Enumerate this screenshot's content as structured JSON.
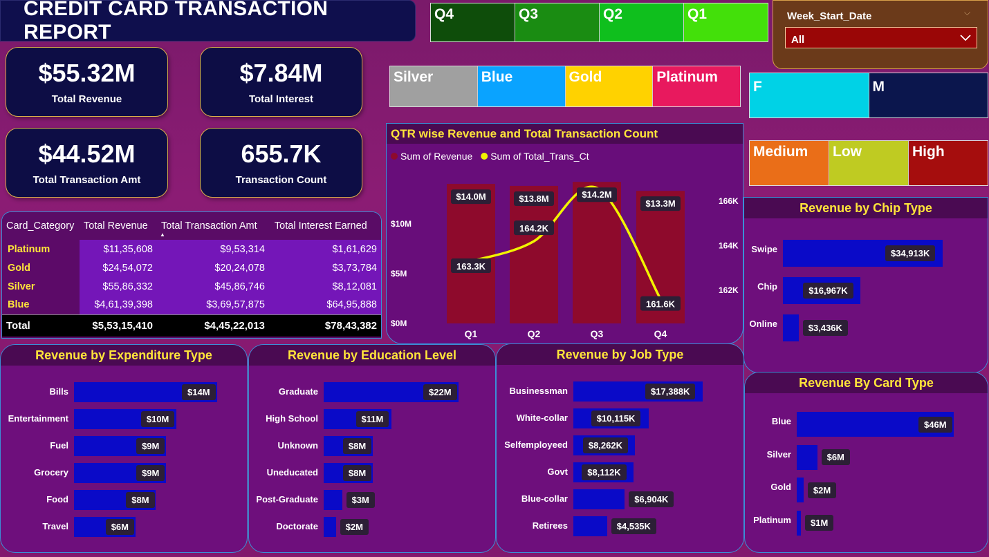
{
  "header": {
    "title": "CREDIT CARD TRANSACTION REPORT"
  },
  "kpis": [
    {
      "value": "$55.32M",
      "label": "Total Revenue"
    },
    {
      "value": "$7.84M",
      "label": "Total Interest"
    },
    {
      "value": "$44.52M",
      "label": "Total Transaction Amt"
    },
    {
      "value": "655.7K",
      "label": "Transaction Count"
    }
  ],
  "quarter_slicer": [
    {
      "label": "Q4",
      "color": "#0e4d0a"
    },
    {
      "label": "Q3",
      "color": "#1a8c12"
    },
    {
      "label": "Q2",
      "color": "#0fbf1d"
    },
    {
      "label": "Q1",
      "color": "#43e00a"
    }
  ],
  "week_slicer": {
    "label": "Week_Start_Date",
    "value": "All"
  },
  "card_slicer": [
    {
      "label": "Silver",
      "color": "#a0a0a0"
    },
    {
      "label": "Blue",
      "color": "#0aa3ff"
    },
    {
      "label": "Gold",
      "color": "#ffd200"
    },
    {
      "label": "Platinum",
      "color": "#e8195e"
    }
  ],
  "gender_slicer": [
    {
      "label": "F",
      "color": "#00d2e6"
    },
    {
      "label": "M",
      "color": "#0b164d"
    }
  ],
  "income_slicer": [
    {
      "label": "Medium",
      "color": "#ea6e18"
    },
    {
      "label": "Low",
      "color": "#bfcb22"
    },
    {
      "label": "High",
      "color": "#a50d0d"
    }
  ],
  "table": {
    "headers": [
      "Card_Category",
      "Total Revenue",
      "Total Transaction Amt",
      "Total Interest Earned"
    ],
    "rows": [
      [
        "Platinum",
        "$11,35,608",
        "$9,53,314",
        "$1,61,629"
      ],
      [
        "Gold",
        "$24,54,072",
        "$20,24,078",
        "$3,73,784"
      ],
      [
        "Silver",
        "$55,86,332",
        "$45,86,746",
        "$8,12,081"
      ],
      [
        "Blue",
        "$4,61,39,398",
        "$3,69,57,875",
        "$64,95,888"
      ]
    ],
    "total": [
      "Total",
      "$5,53,15,410",
      "$4,45,22,013",
      "$78,43,382"
    ]
  },
  "chart_data": [
    {
      "type": "bar+line",
      "title": "QTR wise Revenue and Total Transaction Count",
      "categories": [
        "Q1",
        "Q2",
        "Q3",
        "Q4"
      ],
      "series": [
        {
          "name": "Sum of Revenue",
          "values": [
            14.0,
            13.8,
            14.2,
            13.3
          ],
          "labels": [
            "$14.0M",
            "$13.8M",
            "$14.2M",
            "$13.3M"
          ],
          "color": "#8e0a2c",
          "axis": "left"
        },
        {
          "name": "Sum of Total_Trans_Ct",
          "values": [
            163.3,
            164.2,
            166.6,
            161.6
          ],
          "labels": [
            "163.3K",
            "164.2K",
            "",
            "161.6K"
          ],
          "color": "#f2f200",
          "axis": "right"
        }
      ],
      "left_ticks": [
        "$0M",
        "$5M",
        "$10M"
      ],
      "right_ticks": [
        "162K",
        "164K",
        "166K"
      ],
      "ylim_left": [
        0,
        15.6
      ],
      "ylim_right": [
        160.5,
        167.5
      ]
    },
    {
      "type": "bar",
      "orientation": "horizontal",
      "title": "Revenue by Chip Type",
      "categories": [
        "Swipe",
        "Chip",
        "Online"
      ],
      "values": [
        34913,
        16967,
        3436
      ],
      "labels": [
        "$34,913K",
        "$16,967K",
        "$3,436K"
      ]
    },
    {
      "type": "bar",
      "orientation": "horizontal",
      "title": "Revenue by Expenditure Type",
      "categories": [
        "Bills",
        "Entertainment",
        "Fuel",
        "Grocery",
        "Food",
        "Travel"
      ],
      "values": [
        14,
        10,
        9,
        9,
        8,
        6
      ],
      "labels": [
        "$14M",
        "$10M",
        "$9M",
        "$9M",
        "$8M",
        "$6M"
      ]
    },
    {
      "type": "bar",
      "orientation": "horizontal",
      "title": "Revenue by Education Level",
      "categories": [
        "Graduate",
        "High School",
        "Unknown",
        "Uneducated",
        "Post-Graduate",
        "Doctorate"
      ],
      "values": [
        22,
        11,
        8,
        8,
        3,
        2
      ],
      "labels": [
        "$22M",
        "$11M",
        "$8M",
        "$8M",
        "$3M",
        "$2M"
      ]
    },
    {
      "type": "bar",
      "orientation": "horizontal",
      "title": "Revenue by Job Type",
      "categories": [
        "Businessman",
        "White-collar",
        "Selfemployeed",
        "Govt",
        "Blue-collar",
        "Retirees"
      ],
      "values": [
        17388,
        10115,
        8262,
        8112,
        6904,
        4535
      ],
      "labels": [
        "$17,388K",
        "$10,115K",
        "$8,262K",
        "$8,112K",
        "$6,904K",
        "$4,535K"
      ]
    },
    {
      "type": "bar",
      "orientation": "horizontal",
      "title": "Revenue By Card Type",
      "categories": [
        "Blue",
        "Silver",
        "Gold",
        "Platinum"
      ],
      "values": [
        46,
        6,
        2,
        1
      ],
      "labels": [
        "$46M",
        "$6M",
        "$2M",
        "$1M"
      ]
    }
  ]
}
